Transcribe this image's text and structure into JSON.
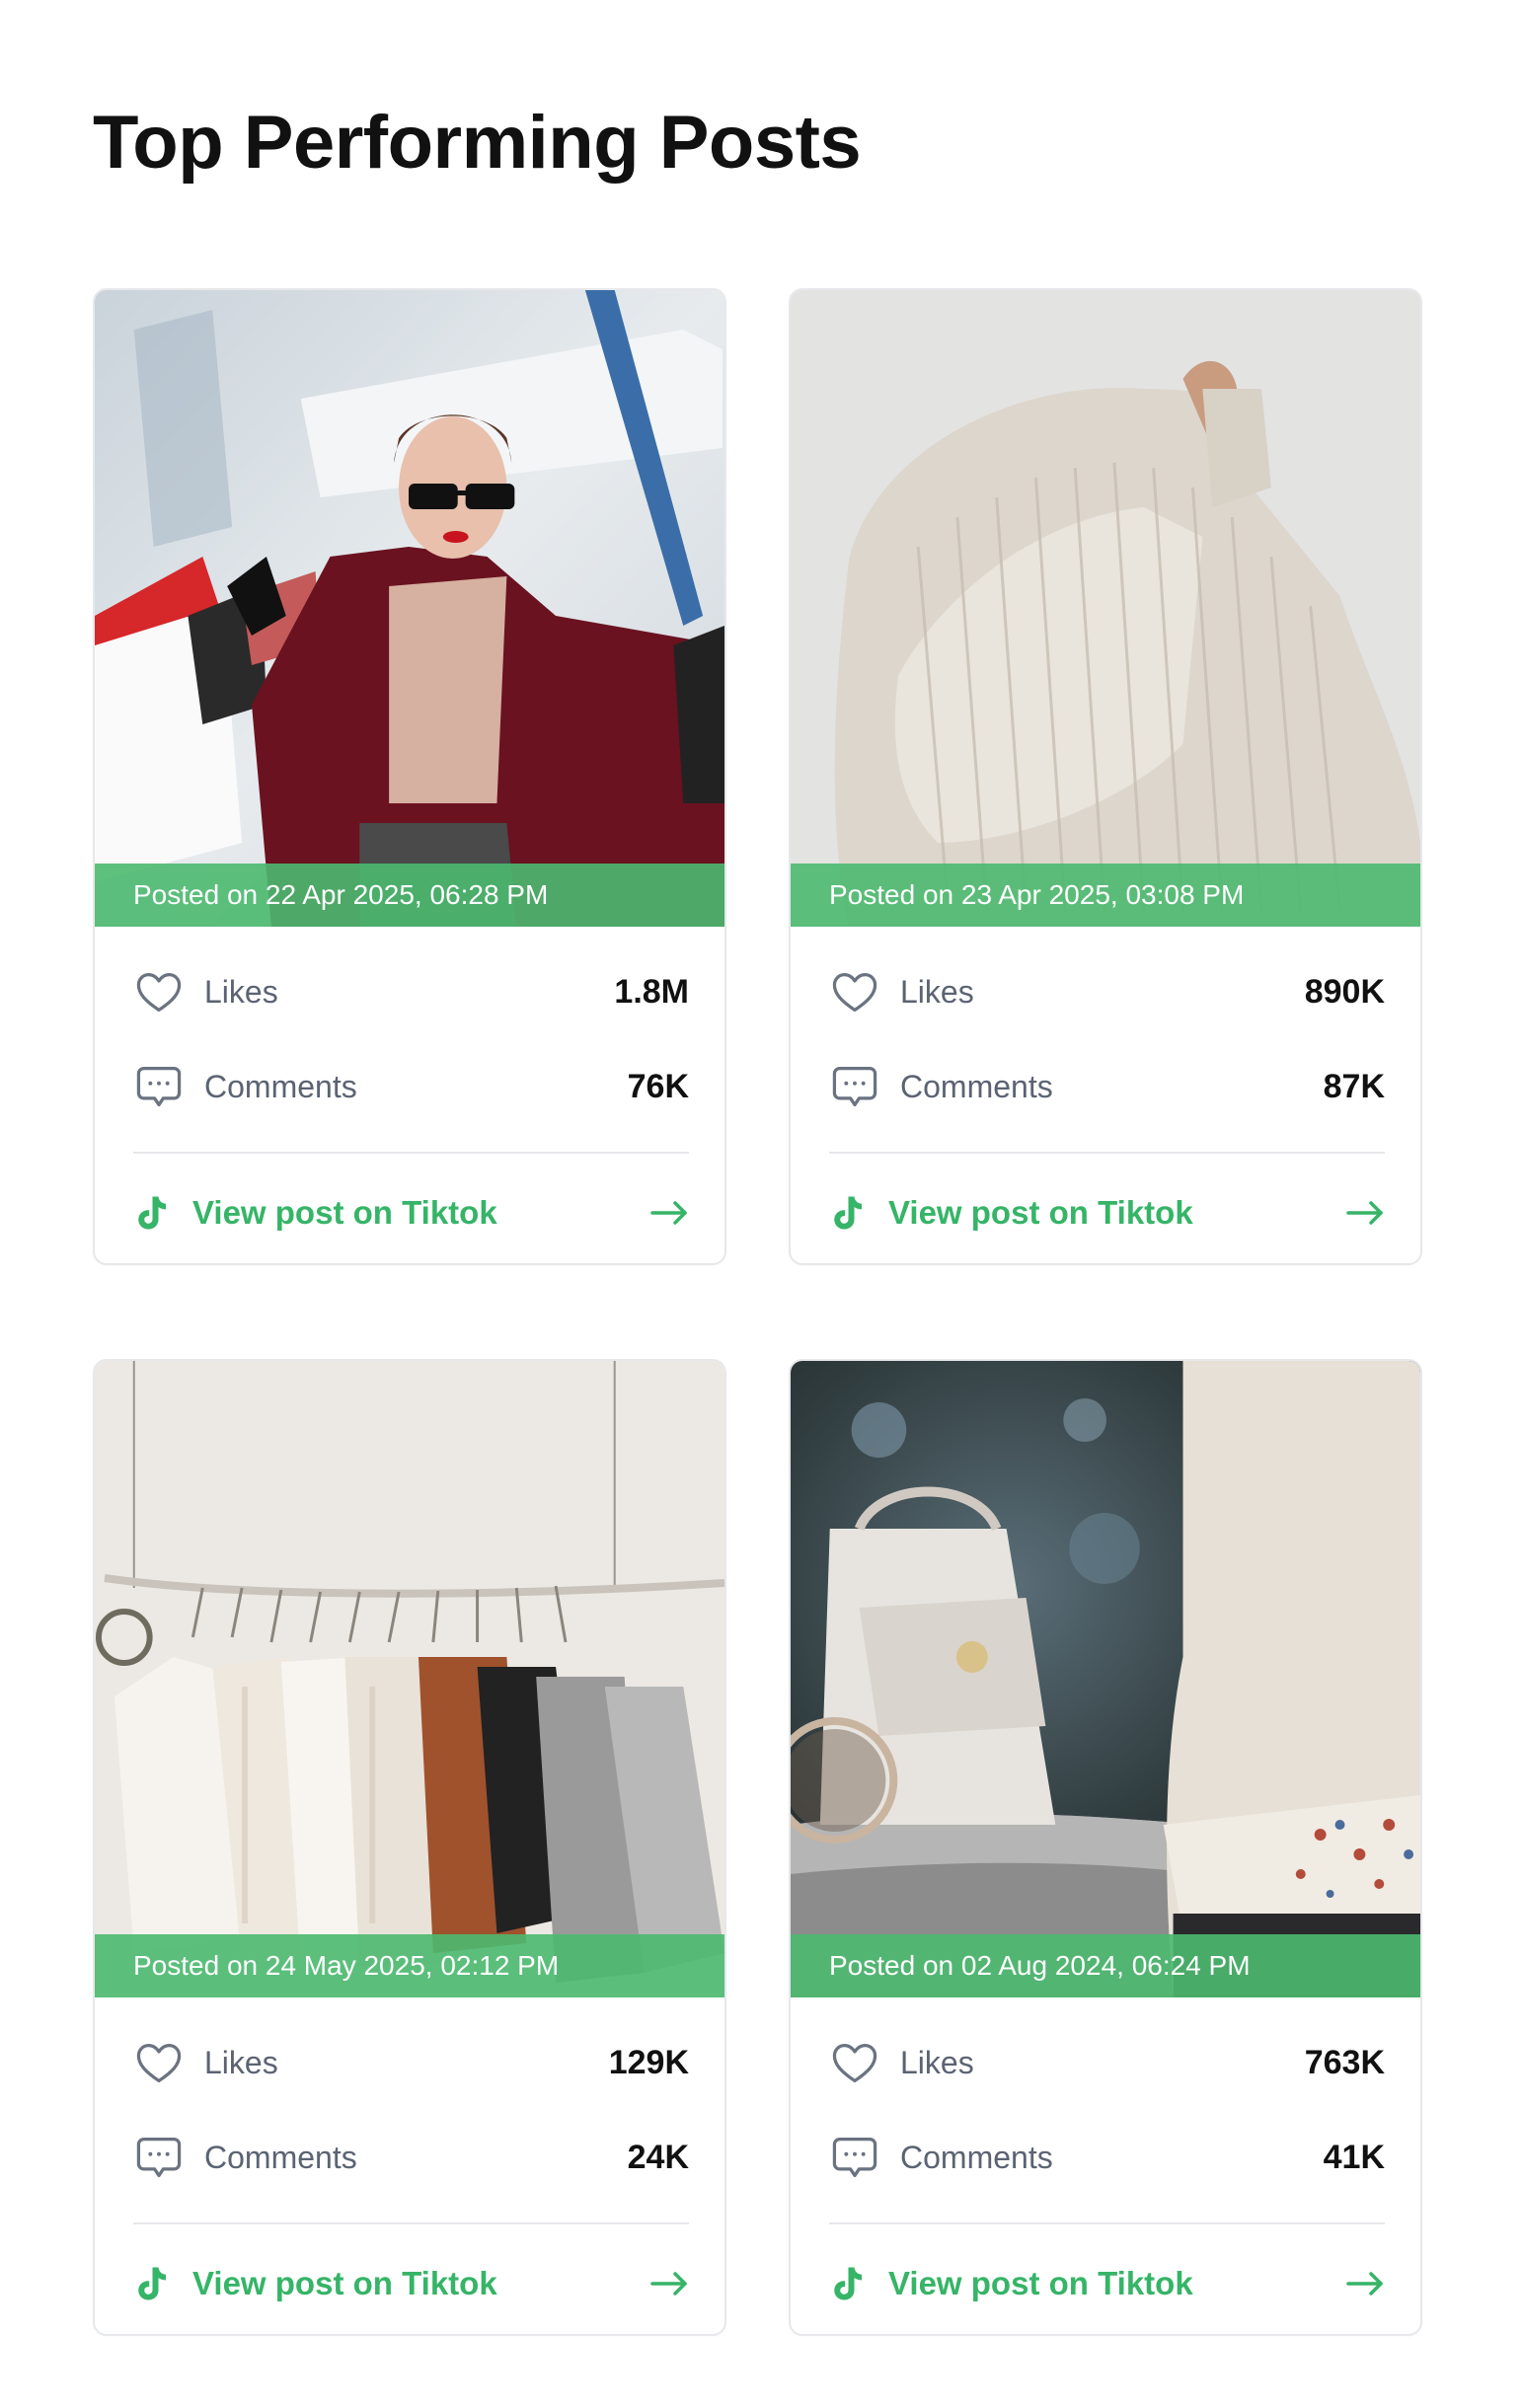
{
  "page": {
    "title": "Top Performing Posts"
  },
  "theme": {
    "accent": "#36b467",
    "banner": "#4bb96f",
    "text": "#111111",
    "muted": "#5b6373",
    "border": "#e6e8eb"
  },
  "posts": [
    {
      "image": "woman-with-shopping-bags-photo",
      "posted": "Posted on 22 Apr 2025, 06:28 PM",
      "likes_label": "Likes",
      "likes": "1.8M",
      "comments_label": "Comments",
      "comments": "76K",
      "link_label": "View post on Tiktok",
      "icons": [
        "heart-icon",
        "comment-icon",
        "tiktok-icon",
        "arrow-right-icon"
      ]
    },
    {
      "image": "knit-sweater-photo",
      "posted": "Posted on 23 Apr 2025, 03:08 PM",
      "likes_label": "Likes",
      "likes": "890K",
      "comments_label": "Comments",
      "comments": "87K",
      "link_label": "View post on Tiktok",
      "icons": [
        "heart-icon",
        "comment-icon",
        "tiktok-icon",
        "arrow-right-icon"
      ]
    },
    {
      "image": "clothes-rack-photo",
      "posted": "Posted on 24 May 2025, 02:12 PM",
      "likes_label": "Likes",
      "likes": "129K",
      "comments_label": "Comments",
      "comments": "24K",
      "link_label": "View post on Tiktok",
      "icons": [
        "heart-icon",
        "comment-icon",
        "tiktok-icon",
        "arrow-right-icon"
      ]
    },
    {
      "image": "white-handbag-and-sunglasses-photo",
      "posted": "Posted on 02 Aug 2024, 06:24 PM",
      "likes_label": "Likes",
      "likes": "763K",
      "comments_label": "Comments",
      "comments": "41K",
      "link_label": "View post on Tiktok",
      "icons": [
        "heart-icon",
        "comment-icon",
        "tiktok-icon",
        "arrow-right-icon"
      ]
    }
  ]
}
